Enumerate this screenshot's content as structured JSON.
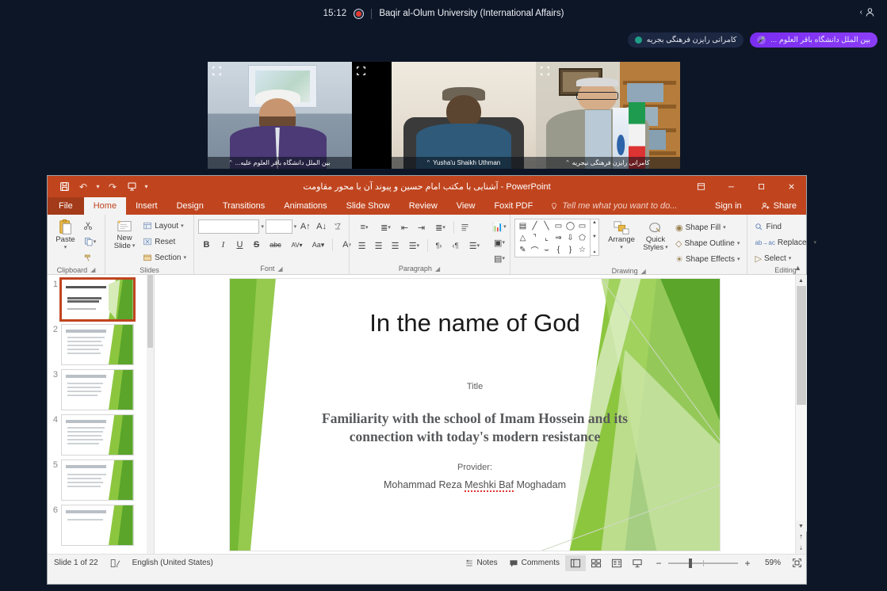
{
  "meeting": {
    "clock": "15:12",
    "recording_icon": "record-dot-icon",
    "title": "Baqir al-Olum University (International Affairs)",
    "people_icon": "people-icon",
    "pills": [
      {
        "label": "کامرانی رایزن فرهنگی بجریه",
        "state": "muted"
      },
      {
        "label": "بین الملل دانشگاه باقر العلوم ...",
        "state": "speaking"
      }
    ],
    "tiles": [
      {
        "name": "بین الملل دانشگاه باقر العلوم علیه...",
        "active": true,
        "expand_icon": "expand-icon"
      },
      {
        "name": "Yusha'u Shaikh Uthman",
        "active": false,
        "expand_icon": "expand-icon"
      },
      {
        "name": "کامرانی رایزن فرهنگی نیجریه",
        "active": false,
        "expand_icon": "expand-icon"
      }
    ]
  },
  "ppt": {
    "window_title": "آشنایی با مکتب امام حسین و پیوند آن با محور مقاومت - PowerPoint",
    "quick_access": [
      {
        "name": "save-icon",
        "glyph": "💾"
      },
      {
        "name": "undo-icon",
        "glyph": "↶"
      },
      {
        "name": "redo-icon",
        "glyph": "↷"
      },
      {
        "name": "start-presentation-icon",
        "glyph": "⬜"
      },
      {
        "name": "customize-quick-access-icon",
        "glyph": "▾"
      }
    ],
    "window_buttons": [
      {
        "name": "ribbon-display-options-button",
        "glyph": "⬚"
      },
      {
        "name": "minimize-button",
        "glyph": "–"
      },
      {
        "name": "restore-button",
        "glyph": "❐"
      },
      {
        "name": "close-button",
        "glyph": "✕"
      }
    ],
    "tabs": [
      {
        "label": "File",
        "active": false,
        "type": "file"
      },
      {
        "label": "Home",
        "active": true,
        "type": "normal"
      },
      {
        "label": "Insert",
        "active": false,
        "type": "normal"
      },
      {
        "label": "Design",
        "active": false,
        "type": "normal"
      },
      {
        "label": "Transitions",
        "active": false,
        "type": "normal"
      },
      {
        "label": "Animations",
        "active": false,
        "type": "normal"
      },
      {
        "label": "Slide Show",
        "active": false,
        "type": "normal"
      },
      {
        "label": "Review",
        "active": false,
        "type": "normal"
      },
      {
        "label": "View",
        "active": false,
        "type": "normal"
      },
      {
        "label": "Foxit PDF",
        "active": false,
        "type": "normal"
      }
    ],
    "tell_me": "Tell me what you want to do...",
    "tell_me_icon": "lightbulb-icon",
    "sign_in": "Sign in",
    "share": "Share",
    "share_icon": "share-person-icon",
    "groups": {
      "clipboard": {
        "label": "Clipboard",
        "paste": "Paste",
        "items": [
          {
            "label": "Cut",
            "icon": "scissors-icon"
          },
          {
            "label": "Copy",
            "icon": "copy-icon"
          },
          {
            "label": "Format Painter",
            "icon": "format-painter-icon"
          }
        ]
      },
      "slides": {
        "label": "Slides",
        "new_slide": "New\nSlide",
        "new_slide_line1": "New",
        "new_slide_line2": "Slide",
        "items": [
          {
            "label": "Layout",
            "icon": "layout-icon"
          },
          {
            "label": "Reset",
            "icon": "reset-icon"
          },
          {
            "label": "Section",
            "icon": "section-icon"
          }
        ]
      },
      "font": {
        "label": "Font",
        "font_name": "",
        "font_size": "",
        "buttons": [
          "B",
          "I",
          "U",
          "S",
          "abc",
          "AV",
          "Aa",
          "A"
        ]
      },
      "paragraph": {
        "label": "Paragraph"
      },
      "drawing": {
        "label": "Drawing",
        "arrange": "Arrange",
        "quick_styles_line1": "Quick",
        "quick_styles_line2": "Styles",
        "shape_fill": "Shape Fill",
        "shape_outline": "Shape Outline",
        "shape_effects": "Shape Effects"
      },
      "editing": {
        "label": "Editing",
        "find": "Find",
        "replace": "Replace",
        "select": "Select"
      }
    },
    "thumbnails": [
      {
        "number": "1",
        "selected": true
      },
      {
        "number": "2",
        "selected": false
      },
      {
        "number": "3",
        "selected": false
      },
      {
        "number": "4",
        "selected": false
      },
      {
        "number": "5",
        "selected": false
      },
      {
        "number": "6",
        "selected": false
      }
    ],
    "slide": {
      "heading": "In the name of God",
      "title_label": "Title",
      "main_title": "Familiarity with the school of Imam Hossein and its connection with today's modern resistance",
      "provider_label": "Provider:",
      "author": "Mohammad Reza Meshki Baf Moghadam",
      "author_part1": "Mohammad Reza ",
      "author_misspelled": "Meshki Baf",
      "author_part2": " Moghadam"
    },
    "status": {
      "slide_counter": "Slide 1 of 22",
      "accessibility_icon": "accessibility-icon",
      "language": "English (United States)",
      "notes": "Notes",
      "notes_icon": "notes-icon",
      "comments": "Comments",
      "comments_icon": "comment-icon",
      "views": [
        {
          "name": "normal-view-button",
          "glyph": "▤",
          "active": true
        },
        {
          "name": "slide-sorter-button",
          "glyph": "☷",
          "active": false
        },
        {
          "name": "reading-view-button",
          "glyph": "☰",
          "active": false
        },
        {
          "name": "slide-show-button",
          "glyph": "▭",
          "active": false
        }
      ],
      "zoom_out": "−",
      "zoom_in": "+",
      "zoom_level": "59%",
      "fit_icon": "fit-to-window-icon"
    }
  }
}
